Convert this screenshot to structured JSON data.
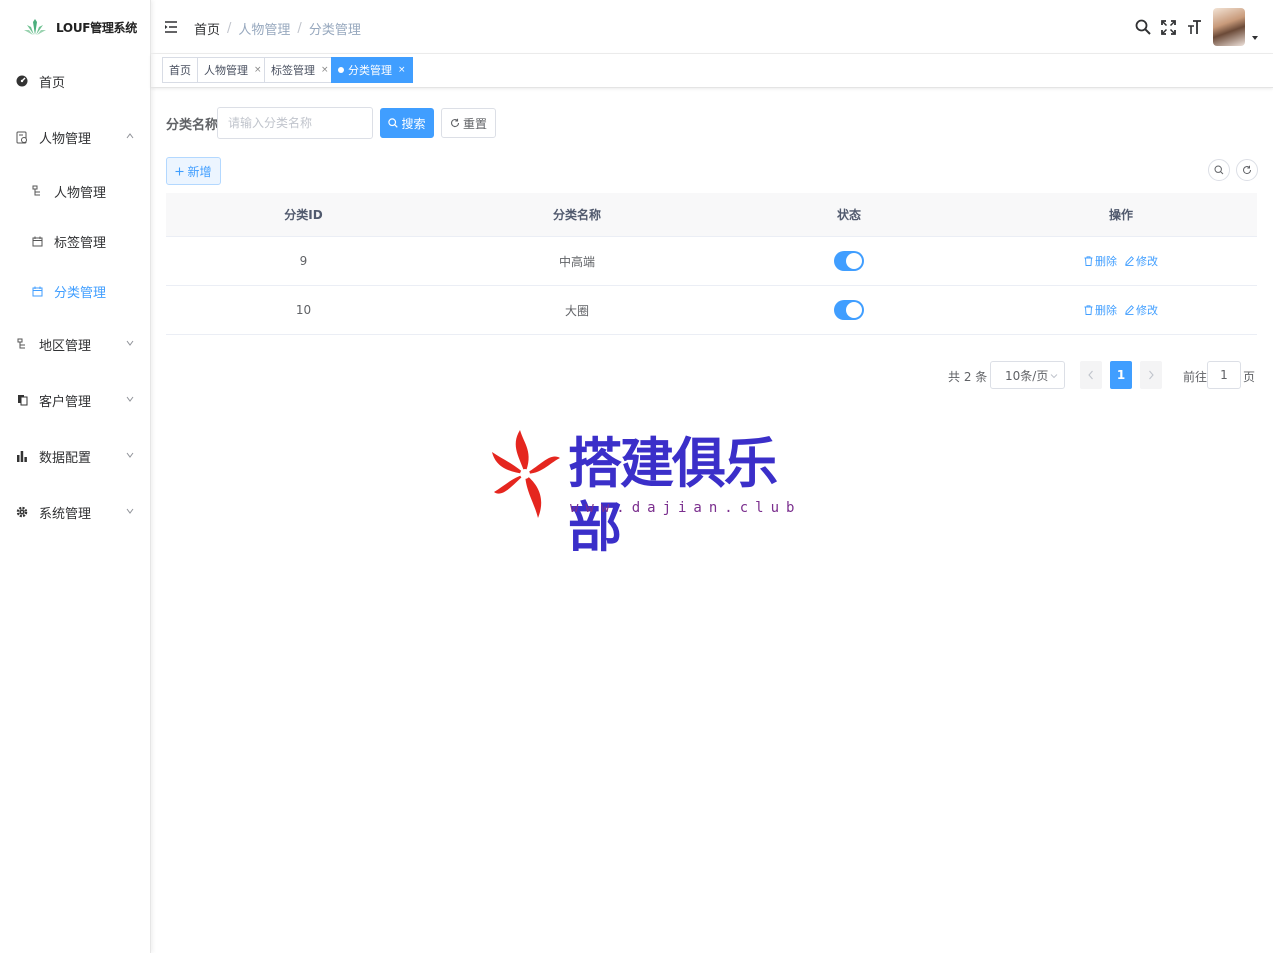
{
  "app": {
    "title": "LOUF管理系统"
  },
  "sidebar": {
    "items": [
      {
        "label": "首页"
      },
      {
        "label": "人物管理"
      },
      {
        "label": "人物管理"
      },
      {
        "label": "标签管理"
      },
      {
        "label": "分类管理"
      },
      {
        "label": "地区管理"
      },
      {
        "label": "客户管理"
      },
      {
        "label": "数据配置"
      },
      {
        "label": "系统管理"
      }
    ]
  },
  "breadcrumb": [
    "首页",
    "人物管理",
    "分类管理"
  ],
  "tags": [
    {
      "label": "首页"
    },
    {
      "label": "人物管理"
    },
    {
      "label": "标签管理"
    },
    {
      "label": "分类管理"
    }
  ],
  "tag_close": "×",
  "search": {
    "label": "分类名称",
    "placeholder": "请输入分类名称",
    "search_button": "搜索",
    "reset_button": "重置"
  },
  "toolbar": {
    "add_button": "新增"
  },
  "table": {
    "columns": [
      "分类ID",
      "分类名称",
      "状态",
      "操作"
    ],
    "rows": [
      {
        "id": "9",
        "name": "中高端",
        "enabled": true
      },
      {
        "id": "10",
        "name": "大圈",
        "enabled": true
      }
    ],
    "delete_label": "删除",
    "edit_label": "修改"
  },
  "pagination": {
    "total": "共 2 条",
    "page_size": "10条/页",
    "current_page": "1",
    "goto_label": "前往",
    "goto_value": "1",
    "page_suffix": "页"
  },
  "watermark": {
    "title": "搭建俱乐部",
    "url": "www.dajian.club"
  },
  "colors": {
    "primary": "#409eff",
    "watermark_blue": "#3b2fc9",
    "watermark_red": "#e5261f"
  }
}
